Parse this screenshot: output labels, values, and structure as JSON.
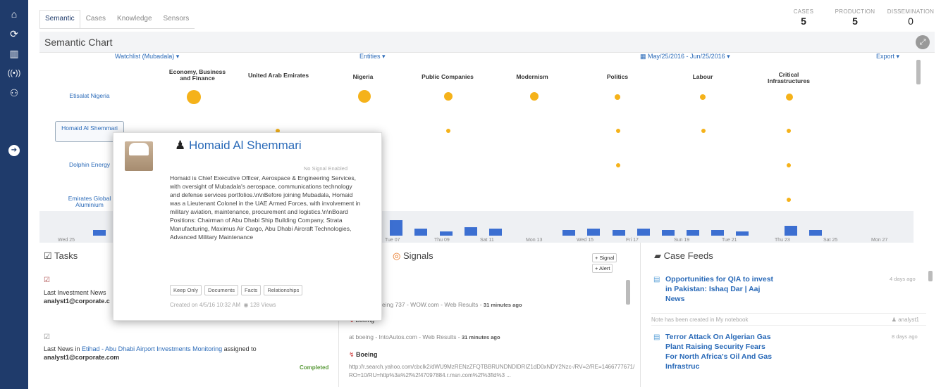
{
  "tabs": [
    "Semantic",
    "Cases",
    "Knowledge",
    "Sensors"
  ],
  "stats": [
    {
      "label": "CASES",
      "value": "5"
    },
    {
      "label": "PRODUCTION",
      "value": "5"
    },
    {
      "label": "DISSEMINATION",
      "value": "0"
    }
  ],
  "chart": {
    "title": "Semantic Chart",
    "watchlist": "Watchlist (Mubadala) ▾",
    "entities": "Entities ▾",
    "daterange": "May/25/2016 - Jun/25/2016 ▾",
    "export": "Export ▾",
    "columns": [
      "Economy, Business and Finance",
      "United Arab Emirates",
      "Nigeria",
      "Public Companies",
      "Modernism",
      "Politics",
      "Labour",
      "Critical Infrastructures"
    ],
    "rows": [
      "Etisalat Nigeria",
      "Homaid Al Shemmari",
      "Dolphin Energy",
      "Emirates Global Aluminium"
    ],
    "timeline_labels": [
      "Wed 25",
      "Tue 07",
      "Thu 09",
      "Sat 11",
      "Mon 13",
      "Wed 15",
      "Fri 17",
      "Sun 19",
      "Tue 21",
      "Thu 23",
      "Sat 25",
      "Mon 27"
    ]
  },
  "popup": {
    "name": "Homaid Al Shemmari",
    "no_signal": "No Signal Enabled",
    "bio": "Homaid is Chief Executive Officer, Aerospace & Engineering Services, with oversight of Mubadala's aerospace, communications technology and defense services portfolios.\\n\\nBefore joining Mubadala, Homaid was a Lieutenant Colonel in the UAE Armed Forces, with involvement in military aviation, maintenance, procurement and logistics.\\n\\nBoard Positions: Chairman of Abu Dhabi Ship Building Company, Strata Manufacturing, Maximus Air Cargo, Abu Dhabi Aircraft Technologies, Advanced Military Maintenance",
    "buttons": [
      "Keep Only",
      "Documents",
      "Facts",
      "Relationships"
    ],
    "created": "Created on 4/5/16 10:32 AM",
    "views": "128 Views"
  },
  "tasks": {
    "title": "Tasks",
    "item1_text": "Last Investment News",
    "item1_user": "analyst1@corporate.c",
    "item2_prefix": "Last News in ",
    "item2_link": "Etihad - Abu Dhabi Airport Investments Monitoring",
    "item2_suffix": " assigned to",
    "item2_user": "analyst1@corporate.com",
    "item2_status": "Completed"
  },
  "signals": {
    "title": "Signals",
    "add_signal": "+ Signal",
    "add_alert": "+ Alert",
    "s1": "eing 737 - WOW.com - Web Results - ",
    "s1_time": "31 minutes ago",
    "s2_title": "Boeing",
    "s2": "at boeing - IntoAutos.com - Web Results - ",
    "s2_time": "31 minutes ago",
    "s3_title": "Boeing",
    "s3_url": "http://r.search.yahoo.com/cbclk2/dWU9MzRENzZFQTBBRUNDNDlDRIZ1dD0xNDY2Nzc-/RV=2/RE=1466777671/RO=10/RU=http%3a%2f%2f47097884.r.msn.com%2f%3fld%3 ..."
  },
  "feeds": {
    "title": "Case Feeds",
    "f1_title": "Opportunities for QIA to invest in Pakistan: Ishaq Dar | Aaj News",
    "f1_time": "4 days ago",
    "f1_note": "Note has been created in My notebook",
    "f1_user": "analyst1",
    "f2_title": "Terror Attack On Algerian Gas Plant Raising Security Fears For North Africa's Oil And Gas Infrastruc",
    "f2_time": "8 days ago"
  }
}
